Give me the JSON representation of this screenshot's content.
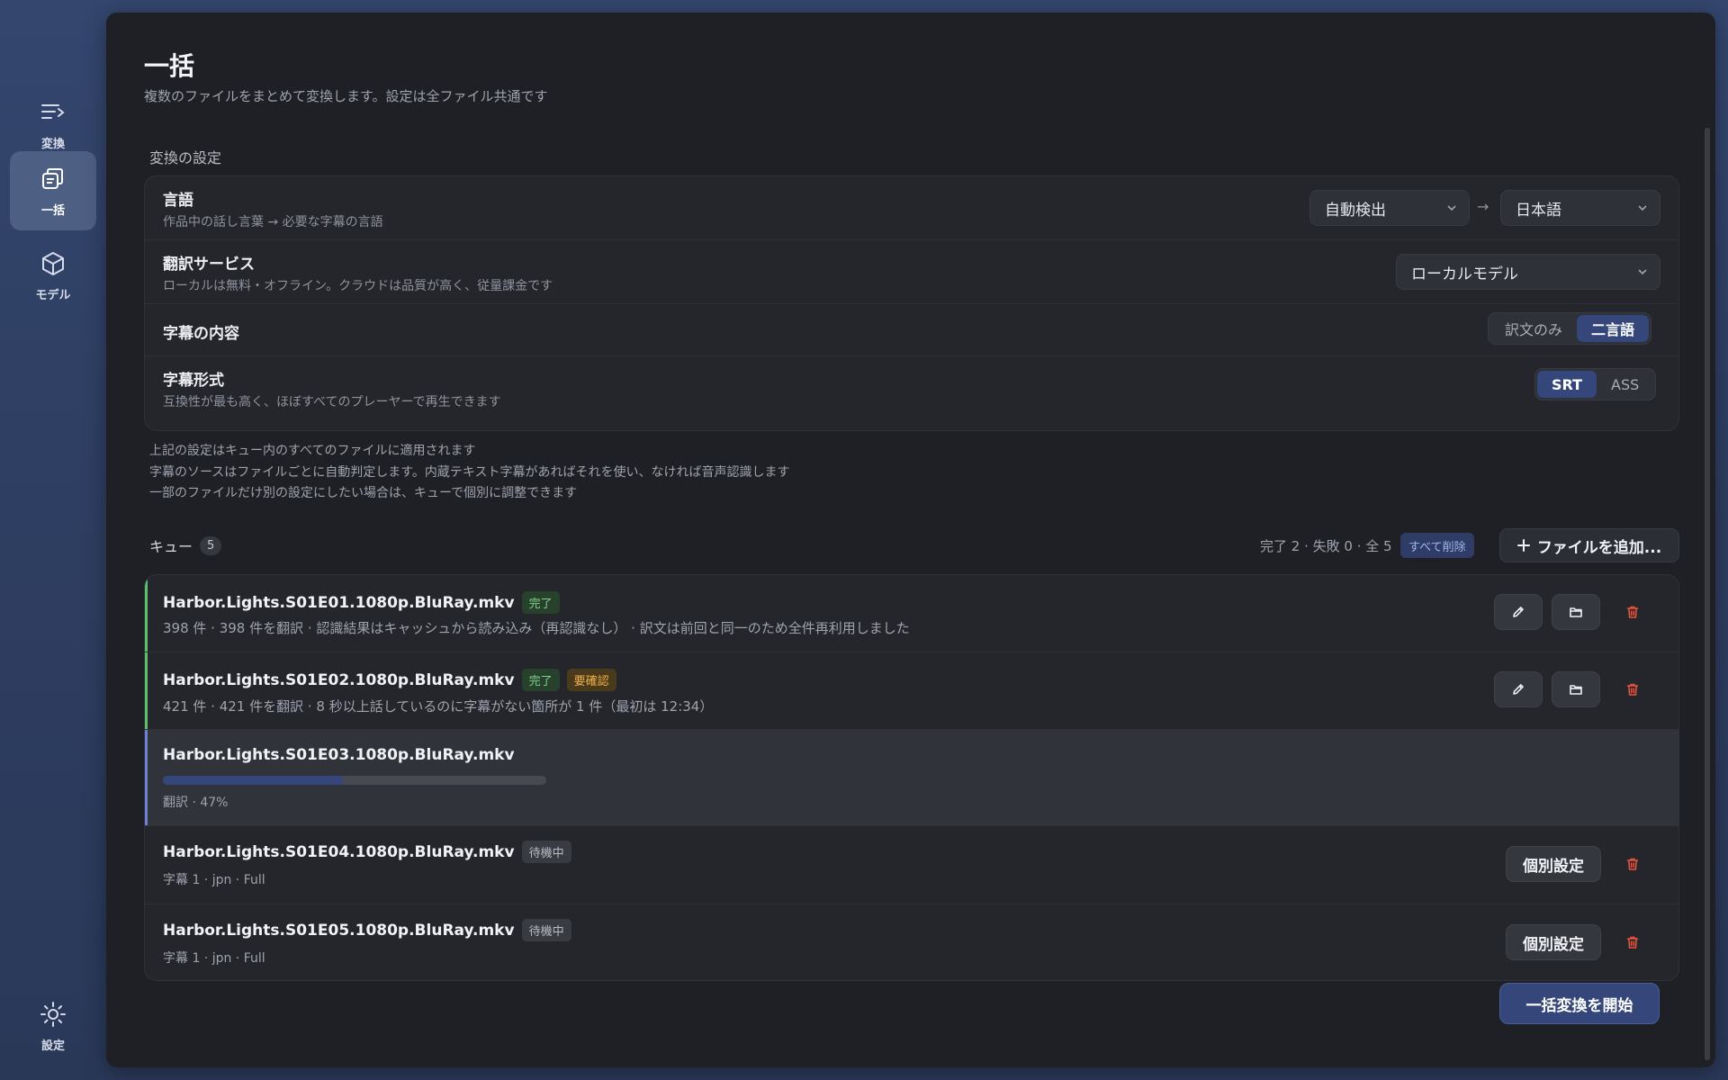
{
  "sidebar": {
    "items": [
      {
        "label": "変換",
        "icon": "convert-icon"
      },
      {
        "label": "一括",
        "icon": "batch-icon"
      },
      {
        "label": "モデル",
        "icon": "cube-icon"
      }
    ],
    "settings_label": "設定"
  },
  "page": {
    "title": "一括",
    "subtitle": "複数のファイルをまとめて変換します。設定は全ファイル共通です"
  },
  "settings": {
    "section_label": "変換の設定",
    "language": {
      "title": "言語",
      "desc": "作品中の話し言葉 → 必要な字幕の言語",
      "source": "自動検出",
      "target": "日本語",
      "arrow": "→"
    },
    "translation": {
      "title": "翻訳サービス",
      "desc": "ローカルは無料・オフライン。クラウドは品質が高く、従量課金です",
      "value": "ローカルモデル"
    },
    "content": {
      "title": "字幕の内容",
      "options": [
        "訳文のみ",
        "二言語"
      ],
      "selected": "二言語"
    },
    "format": {
      "title": "字幕形式",
      "desc": "互換性が最も高く、ほぼすべてのプレーヤーで再生できます",
      "options": [
        "SRT",
        "ASS"
      ],
      "selected": "SRT"
    },
    "notes": [
      "上記の設定はキュー内のすべてのファイルに適用されます",
      "字幕のソースはファイルごとに自動判定します。内蔵テキスト字幕があればそれを使い、なければ音声認識します",
      "一部のファイルだけ別の設定にしたい場合は、キューで個別に調整できます"
    ]
  },
  "queue": {
    "label": "キュー",
    "count": "5",
    "stats": "完了 2 · 失敗 0 · 全 5",
    "clear_all": "すべて削除",
    "add_files": "ファイルを追加...",
    "items": [
      {
        "name": "Harbor.Lights.S01E01.1080p.BluRay.mkv",
        "badge": "完了",
        "meta": "398 件 · 398 件を翻訳 · 認識結果はキャッシュから読み込み（再認識なし） · 訳文は前回と同一のため全件再利用しました"
      },
      {
        "name": "Harbor.Lights.S01E02.1080p.BluRay.mkv",
        "badge": "完了",
        "badge2": "要確認",
        "meta": "421 件 · 421 件を翻訳 · 8 秒以上話しているのに字幕がない箇所が 1 件（最初は 12:34）"
      },
      {
        "name": "Harbor.Lights.S01E03.1080p.BluRay.mkv",
        "progress": 47,
        "meta": "翻訳 · 47%"
      },
      {
        "name": "Harbor.Lights.S01E04.1080p.BluRay.mkv",
        "badge": "待機中",
        "meta": "字幕 1 · jpn · Full",
        "action": "個別設定"
      },
      {
        "name": "Harbor.Lights.S01E05.1080p.BluRay.mkv",
        "badge": "待機中",
        "meta": "字幕 1 · jpn · Full",
        "action": "個別設定"
      }
    ]
  },
  "start_button": "一括変換を開始",
  "colors": {
    "accent": "#34467a",
    "done_green": "#7fd18a",
    "warning_amber": "#f1b04a",
    "delete_red": "#e5533d"
  }
}
